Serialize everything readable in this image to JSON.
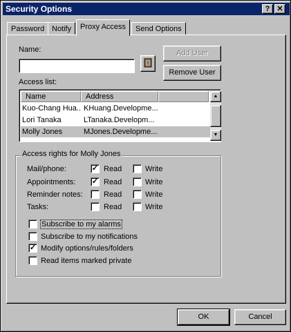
{
  "window": {
    "title": "Security Options",
    "help_label": "?",
    "close_label": "✕"
  },
  "tabs": [
    {
      "label": "Password",
      "active": false
    },
    {
      "label": "Notify",
      "active": false
    },
    {
      "label": "Proxy Access",
      "active": true
    },
    {
      "label": "Send Options",
      "active": false
    }
  ],
  "name_field": {
    "label": "Name:",
    "value": ""
  },
  "address_book_icon": "address-book-icon",
  "buttons": {
    "add_user": "Add User",
    "remove_user": "Remove User",
    "ok": "OK",
    "cancel": "Cancel"
  },
  "access_list": {
    "label": "Access list:",
    "columns": [
      "Name",
      "Address"
    ],
    "rows": [
      {
        "name": "Kuo-Chang Hua...",
        "address": "KHuang.Developme...",
        "selected": false
      },
      {
        "name": "Lori Tanaka",
        "address": "LTanaka.Developm...",
        "selected": false
      },
      {
        "name": "Molly Jones",
        "address": "MJones.Developme...",
        "selected": true
      }
    ]
  },
  "access_rights": {
    "title": "Access rights for Molly Jones",
    "read_label": "Read",
    "write_label": "Write",
    "categories": [
      {
        "label": "Mail/phone:",
        "read": true,
        "write": false
      },
      {
        "label": "Appointments:",
        "read": true,
        "write": false
      },
      {
        "label": "Reminder notes:",
        "read": false,
        "write": false
      },
      {
        "label": "Tasks:",
        "read": false,
        "write": false
      }
    ],
    "options": [
      {
        "label": "Subscribe to my alarms",
        "checked": false,
        "focused": true
      },
      {
        "label": "Subscribe to my notifications",
        "checked": false
      },
      {
        "label": "Modify options/rules/folders",
        "checked": true
      },
      {
        "label": "Read items marked private",
        "checked": false
      }
    ]
  }
}
